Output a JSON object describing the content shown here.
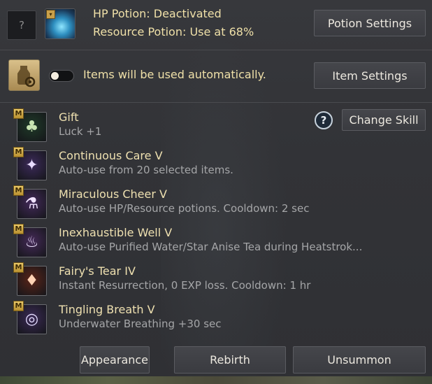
{
  "header": {
    "help_label": "?",
    "hp_status": "HP Potion: Deactivated",
    "resource_status": "Resource Potion: Use at 68%",
    "potion_settings_label": "Potion Settings"
  },
  "auto_use": {
    "toggle_on": false,
    "text": "Items will be used automatically.",
    "item_settings_label": "Item Settings"
  },
  "skills_panel": {
    "help_label": "?",
    "change_skill_label": "Change Skill",
    "badge_label": "M",
    "items": [
      {
        "name": "Gift",
        "desc": "Luck +1",
        "icon": "clover-icon",
        "bg": "#1f3a28",
        "glyph": "♣",
        "glyph_color": "#c8e4b2"
      },
      {
        "name": "Continuous Care V",
        "desc": "Auto-use from 20 selected items.",
        "icon": "fairy-wand-icon",
        "bg": "#3c2a5a",
        "glyph": "✦",
        "glyph_color": "#e8dcff"
      },
      {
        "name": "Miraculous Cheer V",
        "desc": "Auto-use HP/Resource potions. Cooldown: 2 sec",
        "icon": "potion-plus-icon",
        "bg": "#43295a",
        "glyph": "⚗",
        "glyph_color": "#f0e2ff"
      },
      {
        "name": "Inexhaustible Well V",
        "desc": "Auto-use Purified Water/Star Anise Tea during Heatstrok...",
        "icon": "steaming-bowl-icon",
        "bg": "#452a58",
        "glyph": "♨",
        "glyph_color": "#efe4ff"
      },
      {
        "name": "Fairy's Tear IV",
        "desc": "Instant Resurrection, 0 EXP loss. Cooldown: 1 hr",
        "icon": "teardrop-vial-icon",
        "bg": "#5a2418",
        "glyph": "♦",
        "glyph_color": "#ffd2b4"
      },
      {
        "name": "Tingling Breath V",
        "desc": "Underwater Breathing +30 sec",
        "icon": "bubble-breath-icon",
        "bg": "#3b2a56",
        "glyph": "◎",
        "glyph_color": "#e4dcff"
      }
    ]
  },
  "footer": {
    "appearance_label": "Appearance",
    "rebirth_label": "Rebirth",
    "unsummon_label": "Unsummon"
  }
}
